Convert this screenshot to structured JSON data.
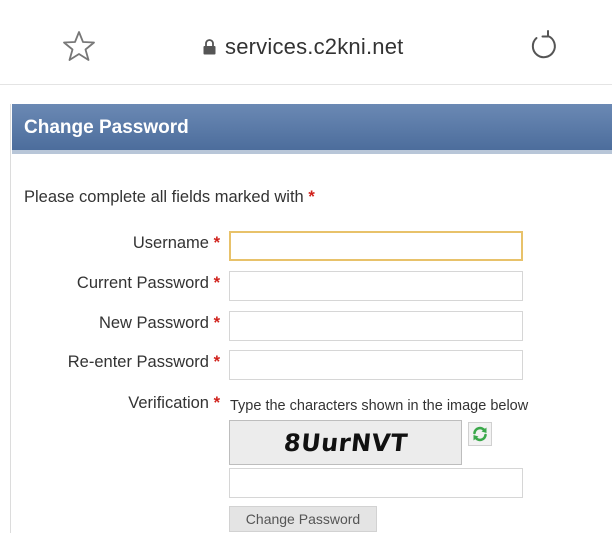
{
  "browser": {
    "url": "services.c2kni.net",
    "icons": {
      "favorite": "star-outline-icon",
      "secure": "lock-icon",
      "reload": "reload-icon"
    }
  },
  "header": {
    "title": "Change Password"
  },
  "form": {
    "intro": "Please complete all fields marked with",
    "required_marker": "*",
    "fields": {
      "username": {
        "label": "Username",
        "value": ""
      },
      "current_password": {
        "label": "Current Password",
        "value": ""
      },
      "new_password": {
        "label": "New Password",
        "value": ""
      },
      "reenter_password": {
        "label": "Re-enter Password",
        "value": ""
      },
      "verification": {
        "label": "Verification",
        "value": ""
      }
    },
    "verification_hint": "Type the characters shown in the image below",
    "captcha_text": "8UurNVT",
    "submit_label": "Change Password"
  },
  "colors": {
    "header_bg": "#5a7aa8",
    "required": "#d0201a",
    "focus_border": "#e8c26a"
  }
}
